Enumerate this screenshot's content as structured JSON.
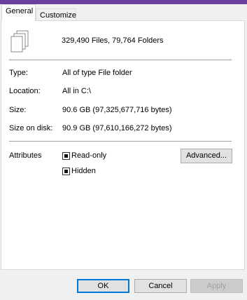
{
  "tabs": [
    {
      "label": "General",
      "active": true
    },
    {
      "label": "Customize",
      "active": false
    }
  ],
  "summary": {
    "icon": "multiple-files-icon",
    "text": "329,490 Files, 79,764 Folders"
  },
  "properties": [
    {
      "label": "Type:",
      "value": "All of type File folder"
    },
    {
      "label": "Location:",
      "value": "All in C:\\"
    },
    {
      "label": "Size:",
      "value": "90.6 GB (97,325,677,716 bytes)"
    },
    {
      "label": "Size on disk:",
      "value": "90.9 GB (97,610,166,272 bytes)"
    }
  ],
  "attributes": {
    "label": "Attributes",
    "readonly_label": "Read-only",
    "readonly_state": "indeterminate",
    "hidden_label": "Hidden",
    "hidden_state": "indeterminate",
    "advanced_label": "Advanced..."
  },
  "buttons": {
    "ok": "OK",
    "cancel": "Cancel",
    "apply": "Apply"
  },
  "colors": {
    "window_accent": "#6b3fa0",
    "default_button_border": "#0078d7"
  }
}
